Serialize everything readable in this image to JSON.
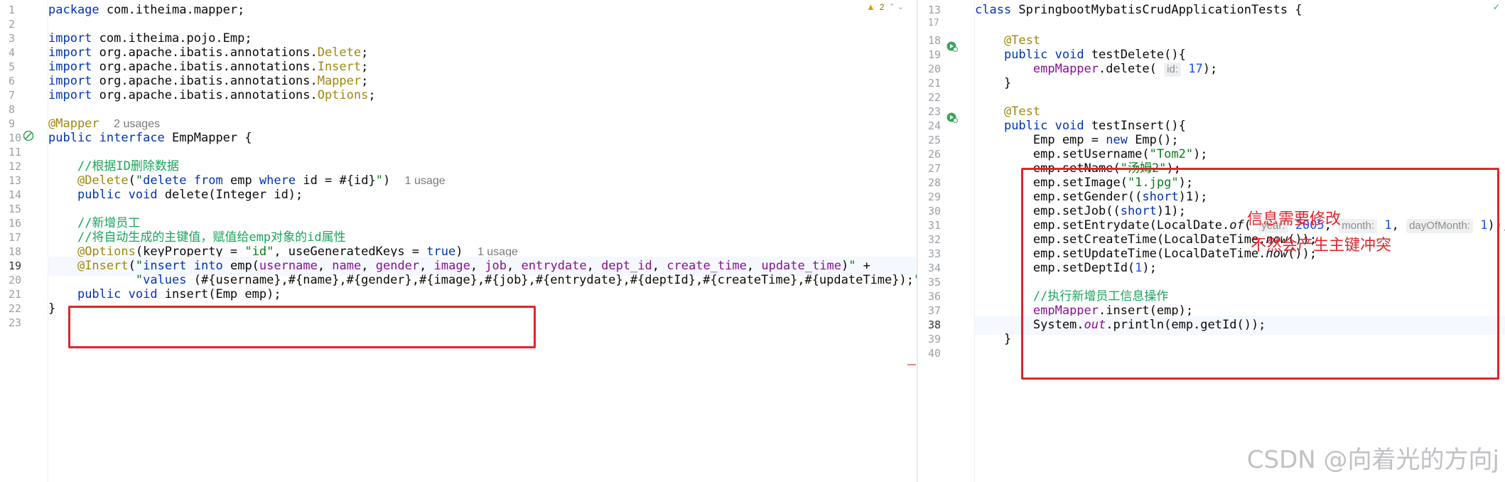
{
  "left_editor": {
    "warning_count": "2",
    "lines": [
      {
        "n": "1",
        "tokens": [
          {
            "t": "package",
            "c": "kw"
          },
          {
            "t": " com.itheima.mapper;",
            "c": "plain"
          }
        ]
      },
      {
        "n": "2",
        "tokens": []
      },
      {
        "n": "3",
        "tokens": [
          {
            "t": "import",
            "c": "kw"
          },
          {
            "t": " com.itheima.pojo.Emp;",
            "c": "plain"
          }
        ]
      },
      {
        "n": "4",
        "tokens": [
          {
            "t": "import",
            "c": "kw"
          },
          {
            "t": " org.apache.ibatis.annotations.",
            "c": "plain"
          },
          {
            "t": "Delete",
            "c": "ann"
          },
          {
            "t": ";",
            "c": "plain"
          }
        ]
      },
      {
        "n": "5",
        "tokens": [
          {
            "t": "import",
            "c": "kw"
          },
          {
            "t": " org.apache.ibatis.annotations.",
            "c": "plain"
          },
          {
            "t": "Insert",
            "c": "ann"
          },
          {
            "t": ";",
            "c": "plain"
          }
        ]
      },
      {
        "n": "6",
        "tokens": [
          {
            "t": "import",
            "c": "kw"
          },
          {
            "t": " org.apache.ibatis.annotations.",
            "c": "plain"
          },
          {
            "t": "Mapper",
            "c": "ann"
          },
          {
            "t": ";",
            "c": "plain"
          }
        ]
      },
      {
        "n": "7",
        "tokens": [
          {
            "t": "import",
            "c": "kw"
          },
          {
            "t": " org.apache.ibatis.annotations.",
            "c": "plain"
          },
          {
            "t": "Options",
            "c": "ann"
          },
          {
            "t": ";",
            "c": "plain"
          }
        ]
      },
      {
        "n": "8",
        "tokens": []
      },
      {
        "n": "9",
        "tokens": [
          {
            "t": "@Mapper",
            "c": "ann"
          },
          {
            "t": "  ",
            "c": "plain"
          },
          {
            "t": "2 usages",
            "c": "hint"
          }
        ]
      },
      {
        "n": "10",
        "tokens": [
          {
            "t": "public",
            "c": "kw"
          },
          {
            "t": " ",
            "c": "plain"
          },
          {
            "t": "interface",
            "c": "kw"
          },
          {
            "t": " EmpMapper {",
            "c": "plain"
          }
        ]
      },
      {
        "n": "11",
        "tokens": []
      },
      {
        "n": "12",
        "tokens": [
          {
            "t": "    ",
            "c": "plain"
          },
          {
            "t": "//根据ID删除数据",
            "c": "cmt-cn"
          }
        ]
      },
      {
        "n": "13",
        "tokens": [
          {
            "t": "    ",
            "c": "plain"
          },
          {
            "t": "@Delete",
            "c": "ann"
          },
          {
            "t": "(",
            "c": "plain"
          },
          {
            "t": "\"",
            "c": "str"
          },
          {
            "t": "delete",
            "c": "kw"
          },
          {
            "t": " ",
            "c": "str"
          },
          {
            "t": "from",
            "c": "kw"
          },
          {
            "t": " emp ",
            "c": "plain"
          },
          {
            "t": "where",
            "c": "kw"
          },
          {
            "t": " id = #{id}",
            "c": "plain"
          },
          {
            "t": "\"",
            "c": "str"
          },
          {
            "t": ")  ",
            "c": "plain"
          },
          {
            "t": "1 usage",
            "c": "hint"
          }
        ]
      },
      {
        "n": "14",
        "tokens": [
          {
            "t": "    ",
            "c": "plain"
          },
          {
            "t": "public",
            "c": "kw"
          },
          {
            "t": " ",
            "c": "plain"
          },
          {
            "t": "void",
            "c": "kw"
          },
          {
            "t": " delete(Integer id);",
            "c": "plain"
          }
        ]
      },
      {
        "n": "15",
        "tokens": []
      },
      {
        "n": "16",
        "tokens": [
          {
            "t": "    ",
            "c": "plain"
          },
          {
            "t": "//新增员工",
            "c": "cmt-cn"
          }
        ]
      },
      {
        "n": "17",
        "tokens": [
          {
            "t": "    ",
            "c": "plain"
          },
          {
            "t": "//将自动生成的主键值，赋值给emp对象的id属性",
            "c": "cmt-cn"
          }
        ]
      },
      {
        "n": "18",
        "tokens": [
          {
            "t": "    ",
            "c": "plain"
          },
          {
            "t": "@Options",
            "c": "ann"
          },
          {
            "t": "(keyProperty = ",
            "c": "plain"
          },
          {
            "t": "\"id\"",
            "c": "str"
          },
          {
            "t": ", useGeneratedKeys = ",
            "c": "plain"
          },
          {
            "t": "true",
            "c": "kw"
          },
          {
            "t": ")  ",
            "c": "plain"
          },
          {
            "t": "1 usage",
            "c": "hint"
          }
        ]
      },
      {
        "n": "19",
        "current": true,
        "tokens": [
          {
            "t": "    ",
            "c": "plain"
          },
          {
            "t": "@Insert",
            "c": "ann"
          },
          {
            "t": "(",
            "c": "plain"
          },
          {
            "t": "\"",
            "c": "str"
          },
          {
            "t": "insert",
            "c": "kw"
          },
          {
            "t": " ",
            "c": "str"
          },
          {
            "t": "into",
            "c": "kw"
          },
          {
            "t": " emp(",
            "c": "plain"
          },
          {
            "t": "username",
            "c": "fld"
          },
          {
            "t": ", ",
            "c": "plain"
          },
          {
            "t": "name",
            "c": "fld"
          },
          {
            "t": ", ",
            "c": "plain"
          },
          {
            "t": "gender",
            "c": "fld"
          },
          {
            "t": ", ",
            "c": "plain"
          },
          {
            "t": "image",
            "c": "fld"
          },
          {
            "t": ", ",
            "c": "plain"
          },
          {
            "t": "job",
            "c": "fld"
          },
          {
            "t": ", ",
            "c": "plain"
          },
          {
            "t": "entrydate",
            "c": "fld"
          },
          {
            "t": ", ",
            "c": "plain"
          },
          {
            "t": "dept_id",
            "c": "fld"
          },
          {
            "t": ", ",
            "c": "plain"
          },
          {
            "t": "create_time",
            "c": "fld"
          },
          {
            "t": ", ",
            "c": "plain"
          },
          {
            "t": "update_time",
            "c": "fld"
          },
          {
            "t": ")",
            "c": "plain"
          },
          {
            "t": "\"",
            "c": "str"
          },
          {
            "t": " +",
            "c": "plain"
          }
        ]
      },
      {
        "n": "20",
        "tokens": [
          {
            "t": "            ",
            "c": "plain"
          },
          {
            "t": "\"",
            "c": "str"
          },
          {
            "t": "values",
            "c": "kw"
          },
          {
            "t": " (#{username},#{name},#{gender},#{image},#{job},#{entrydate},#{deptId},#{createTime},#{updateTime});",
            "c": "plain"
          },
          {
            "t": "\"",
            "c": "str"
          },
          {
            "t": ")",
            "c": "plain"
          }
        ]
      },
      {
        "n": "21",
        "tokens": [
          {
            "t": "    ",
            "c": "plain"
          },
          {
            "t": "public",
            "c": "kw"
          },
          {
            "t": " ",
            "c": "plain"
          },
          {
            "t": "void",
            "c": "kw"
          },
          {
            "t": " insert(Emp emp);",
            "c": "plain"
          }
        ]
      },
      {
        "n": "22",
        "tokens": [
          {
            "t": "}",
            "c": "plain"
          }
        ]
      },
      {
        "n": "23",
        "tokens": []
      }
    ]
  },
  "right_editor": {
    "sticky_header": {
      "n": "13",
      "tokens": [
        {
          "t": "class",
          "c": "kw"
        },
        {
          "t": " SpringbootMybatisCrudApplicationTests {",
          "c": "plain"
        }
      ]
    },
    "lines": [
      {
        "n": "17",
        "tokens": []
      },
      {
        "n": "18",
        "tokens": [
          {
            "t": "    ",
            "c": "plain"
          },
          {
            "t": "@Test",
            "c": "ann"
          }
        ]
      },
      {
        "n": "19",
        "tokens": [
          {
            "t": "    ",
            "c": "plain"
          },
          {
            "t": "public",
            "c": "kw"
          },
          {
            "t": " ",
            "c": "plain"
          },
          {
            "t": "void",
            "c": "kw"
          },
          {
            "t": " testDelete(){",
            "c": "plain"
          }
        ]
      },
      {
        "n": "20",
        "tokens": [
          {
            "t": "        ",
            "c": "plain"
          },
          {
            "t": "empMapper",
            "c": "fld"
          },
          {
            "t": ".delete( ",
            "c": "plain"
          },
          {
            "t": "id:",
            "c": "inlay"
          },
          {
            "t": " ",
            "c": "plain"
          },
          {
            "t": "17",
            "c": "num"
          },
          {
            "t": ");",
            "c": "plain"
          }
        ]
      },
      {
        "n": "21",
        "tokens": [
          {
            "t": "    }",
            "c": "plain"
          }
        ]
      },
      {
        "n": "22",
        "tokens": []
      },
      {
        "n": "23",
        "tokens": [
          {
            "t": "    ",
            "c": "plain"
          },
          {
            "t": "@Test",
            "c": "ann"
          }
        ]
      },
      {
        "n": "24",
        "tokens": [
          {
            "t": "    ",
            "c": "plain"
          },
          {
            "t": "public",
            "c": "kw"
          },
          {
            "t": " ",
            "c": "plain"
          },
          {
            "t": "void",
            "c": "kw"
          },
          {
            "t": " testInsert(){",
            "c": "plain"
          }
        ]
      },
      {
        "n": "25",
        "tokens": [
          {
            "t": "        Emp emp = ",
            "c": "plain"
          },
          {
            "t": "new",
            "c": "kw"
          },
          {
            "t": " Emp();",
            "c": "plain"
          }
        ]
      },
      {
        "n": "26",
        "tokens": [
          {
            "t": "        emp.setUsername(",
            "c": "plain"
          },
          {
            "t": "\"Tom2\"",
            "c": "str"
          },
          {
            "t": ");",
            "c": "plain"
          }
        ]
      },
      {
        "n": "27",
        "tokens": [
          {
            "t": "        emp.setName(",
            "c": "plain"
          },
          {
            "t": "\"汤姆2\"",
            "c": "str"
          },
          {
            "t": ");",
            "c": "plain"
          }
        ]
      },
      {
        "n": "28",
        "tokens": [
          {
            "t": "        emp.setImage(",
            "c": "plain"
          },
          {
            "t": "\"1.jpg\"",
            "c": "str"
          },
          {
            "t": ");",
            "c": "plain"
          }
        ]
      },
      {
        "n": "29",
        "tokens": [
          {
            "t": "        emp.setGender((",
            "c": "plain"
          },
          {
            "t": "short",
            "c": "kw"
          },
          {
            "t": ")1);",
            "c": "plain"
          }
        ]
      },
      {
        "n": "30",
        "tokens": [
          {
            "t": "        emp.setJob((",
            "c": "plain"
          },
          {
            "t": "short",
            "c": "kw"
          },
          {
            "t": ")1);",
            "c": "plain"
          }
        ]
      },
      {
        "n": "31",
        "tokens": [
          {
            "t": "        emp.setEntrydate(LocalDate.",
            "c": "plain"
          },
          {
            "t": "of",
            "c": "sfn"
          },
          {
            "t": "( ",
            "c": "plain"
          },
          {
            "t": "year:",
            "c": "inlay"
          },
          {
            "t": " ",
            "c": "plain"
          },
          {
            "t": "2005",
            "c": "num"
          },
          {
            "t": ", ",
            "c": "plain"
          },
          {
            "t": "month:",
            "c": "inlay"
          },
          {
            "t": " ",
            "c": "plain"
          },
          {
            "t": "1",
            "c": "num"
          },
          {
            "t": ", ",
            "c": "plain"
          },
          {
            "t": "dayOfMonth:",
            "c": "inlay"
          },
          {
            "t": " ",
            "c": "plain"
          },
          {
            "t": "1",
            "c": "num"
          },
          {
            "t": "));",
            "c": "plain"
          }
        ]
      },
      {
        "n": "32",
        "tokens": [
          {
            "t": "        emp.setCreateTime(LocalDateTime.",
            "c": "plain"
          },
          {
            "t": "now",
            "c": "sfn"
          },
          {
            "t": "());",
            "c": "plain"
          }
        ]
      },
      {
        "n": "33",
        "tokens": [
          {
            "t": "        emp.setUpdateTime(LocalDateTime.",
            "c": "plain"
          },
          {
            "t": "now",
            "c": "sfn"
          },
          {
            "t": "());",
            "c": "plain"
          }
        ]
      },
      {
        "n": "34",
        "tokens": [
          {
            "t": "        emp.setDeptId(",
            "c": "plain"
          },
          {
            "t": "1",
            "c": "num"
          },
          {
            "t": ");",
            "c": "plain"
          }
        ]
      },
      {
        "n": "35",
        "tokens": []
      },
      {
        "n": "36",
        "tokens": [
          {
            "t": "        ",
            "c": "plain"
          },
          {
            "t": "//执行新增员工信息操作",
            "c": "cmt-cn"
          }
        ]
      },
      {
        "n": "37",
        "tokens": [
          {
            "t": "        ",
            "c": "plain"
          },
          {
            "t": "empMapper",
            "c": "fld"
          },
          {
            "t": ".insert(emp);",
            "c": "plain"
          }
        ]
      },
      {
        "n": "38",
        "current": true,
        "tokens": [
          {
            "t": "        System.",
            "c": "plain"
          },
          {
            "t": "out",
            "c": "fld sfn"
          },
          {
            "t": ".println(emp.getId());",
            "c": "plain"
          }
        ]
      },
      {
        "n": "39",
        "tokens": [
          {
            "t": "    }",
            "c": "plain"
          }
        ]
      },
      {
        "n": "40",
        "tokens": []
      }
    ]
  },
  "annotation": {
    "line1": "信息需要修改",
    "line2": "不然会产生主键冲突"
  },
  "watermark": "CSDN @向着光的方向j",
  "colors": {
    "keyword": "#0033b3",
    "annotation": "#9e880d",
    "string": "#067d17",
    "comment": "#1aa55a",
    "number": "#1750eb",
    "field": "#871094",
    "red_box": "#e2242b"
  },
  "icons": [
    "warning-icon",
    "check-icon",
    "mapper-gutter-icon",
    "run-test-icon"
  ]
}
